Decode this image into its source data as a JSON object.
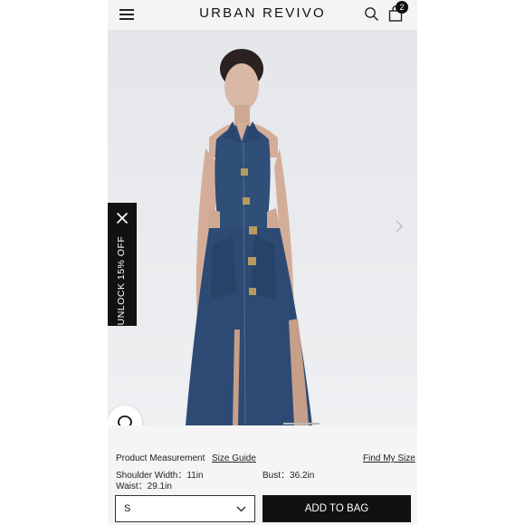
{
  "header": {
    "brand": "URBAN REVIVO",
    "cart_count": "2"
  },
  "promo": {
    "label": "UNLOCK 15% OFF"
  },
  "product": {
    "measurement_label": "Product Measurement",
    "size_guide_label": "Size Guide",
    "find_my_size_label": "Find My Size",
    "shoulder_width": "Shoulder Width：11in",
    "bust": "Bust：36.2in",
    "waist": "Waist：29.1in"
  },
  "actions": {
    "selected_size": "S",
    "add_to_bag_label": "ADD TO BAG"
  },
  "icons": {
    "menu": "menu-icon",
    "search": "search-icon",
    "bag": "shopping-bag-icon",
    "close": "close-icon",
    "chat": "chat-bubble-icon",
    "next": "chevron-right-icon",
    "dropdown": "chevron-down-icon"
  },
  "colors": {
    "header_bg": "#f4f4f4",
    "panel_bg": "#f5f5f5",
    "button_bg": "#111111",
    "denim": "#2f4e78"
  }
}
